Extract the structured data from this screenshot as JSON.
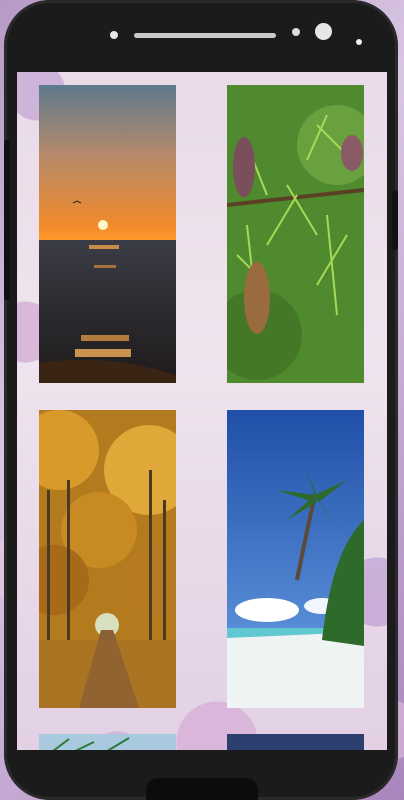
{
  "app": {
    "screen": "wallpaper-gallery"
  },
  "wallpapers": [
    {
      "icon": "sunset-sea-image"
    },
    {
      "icon": "pine-branch-image"
    },
    {
      "icon": "autumn-forest-image"
    },
    {
      "icon": "tropical-beach-image"
    },
    {
      "icon": "partial-wallpaper-image"
    },
    {
      "icon": "partial-wallpaper-image"
    }
  ],
  "colors": {
    "frame": "#1b1b1b",
    "background": "#efe4ee",
    "accent": "#b79ac6"
  }
}
